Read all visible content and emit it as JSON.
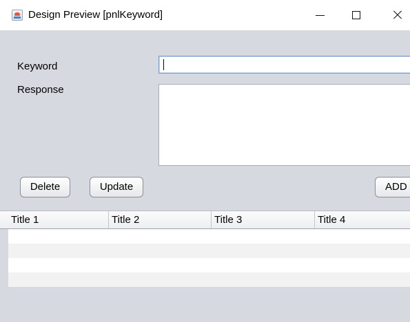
{
  "window": {
    "title": "Design Preview [pnlKeyword]",
    "icon": "java-app-icon",
    "controls": [
      "minimize-icon",
      "maximize-icon",
      "close-icon"
    ]
  },
  "form": {
    "keyword_label": "Keyword",
    "keyword_value": "",
    "response_label": "Response",
    "response_value": ""
  },
  "buttons": {
    "delete": "Delete",
    "update": "Update",
    "add": "ADD"
  },
  "table": {
    "columns": [
      "Title 1",
      "Title 2",
      "Title 3",
      "Title 4"
    ],
    "rows": [
      [
        "",
        "",
        "",
        ""
      ],
      [
        "",
        "",
        "",
        ""
      ],
      [
        "",
        "",
        "",
        ""
      ],
      [
        "",
        "",
        "",
        ""
      ]
    ]
  },
  "colors": {
    "panel_background": "#d6d9df",
    "titlebar_background": "#ffffff",
    "input_focus_border": "#7a9cc6",
    "row_alternate": "#f2f2f2"
  }
}
